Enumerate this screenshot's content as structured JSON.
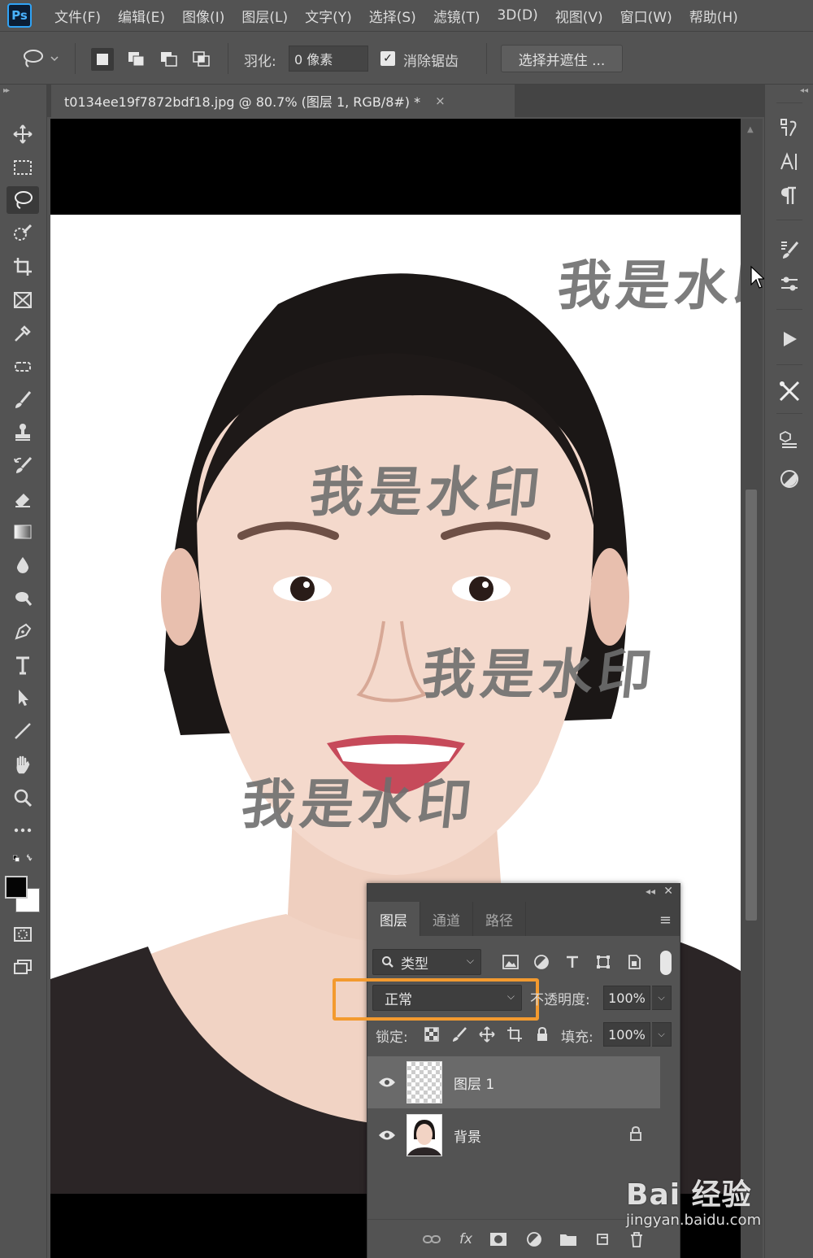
{
  "app": {
    "logo_text": "Ps"
  },
  "menu": [
    "文件(F)",
    "编辑(E)",
    "图像(I)",
    "图层(L)",
    "文字(Y)",
    "选择(S)",
    "滤镜(T)",
    "3D(D)",
    "视图(V)",
    "窗口(W)",
    "帮助(H)"
  ],
  "options_bar": {
    "feather_label": "羽化:",
    "feather_value": "0 像素",
    "antialias_label": "消除锯齿",
    "antialias_checked": true,
    "select_and_mask_label": "选择并遮住 ..."
  },
  "document": {
    "tab_title": "t0134ee19f7872bdf18.jpg @ 80.7% (图层 1, RGB/8#) *",
    "close_glyph": "×",
    "watermark_text": [
      "我是水印",
      "我是水印",
      "我是水印",
      "我是水印"
    ]
  },
  "layers_panel": {
    "tabs": [
      "图层",
      "通道",
      "路径"
    ],
    "active_tab": "图层",
    "filter_kind": "类型",
    "blend_mode": "正常",
    "opacity_label": "不透明度:",
    "opacity_value": "100%",
    "lock_label": "锁定:",
    "fill_label": "填充:",
    "fill_value": "100%",
    "layers": [
      {
        "name": "图层 1",
        "visible": true,
        "selected": true,
        "locked": false
      },
      {
        "name": "背景",
        "visible": true,
        "selected": false,
        "locked": true
      }
    ],
    "bottom_icons": [
      "link-icon",
      "fx-icon",
      "mask-icon",
      "adjustment-icon",
      "folder-icon",
      "new-layer-icon",
      "trash-icon"
    ],
    "fx_text": "fx"
  },
  "colors": {
    "accent_highlight": "#f39a2f",
    "panel_bg": "#535353",
    "canvas_bg": "#000000"
  },
  "page_watermark": {
    "logo": "Bai 经验",
    "url": "jingyan.baidu.com"
  }
}
